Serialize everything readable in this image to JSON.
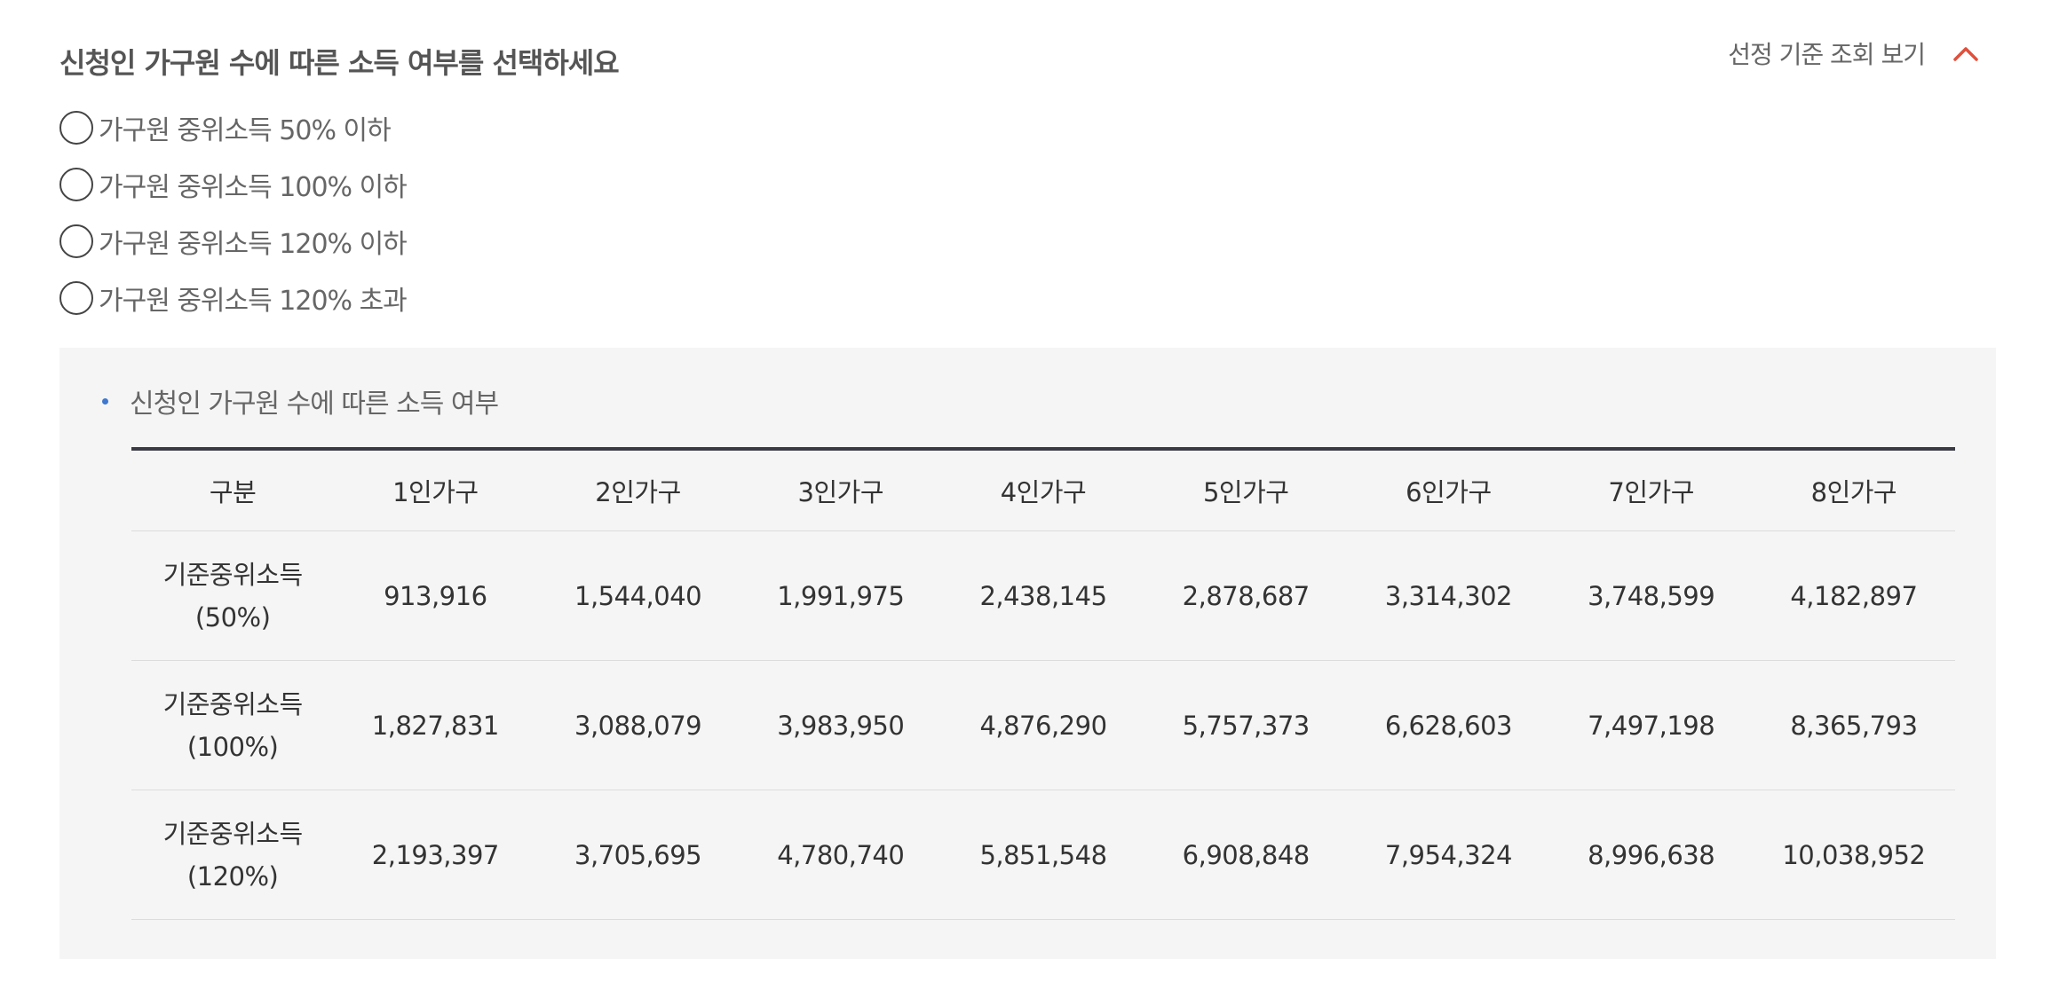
{
  "title": "신청인 가구원 수에 따른 소득 여부를 선택하세요",
  "criteria_toggle": {
    "label": "선정 기준 조회 보기",
    "icon": "chevron-up-icon",
    "icon_color": "#e0503c"
  },
  "options": [
    {
      "label": "가구원 중위소득 50% 이하",
      "selected": false
    },
    {
      "label": "가구원 중위소득 100% 이하",
      "selected": false
    },
    {
      "label": "가구원 중위소득 120% 이하",
      "selected": false
    },
    {
      "label": "가구원 중위소득 120% 초과",
      "selected": false
    }
  ],
  "panel": {
    "heading": "신청인 가구원 수에 따른 소득 여부",
    "bullet_color": "#3e78cf",
    "table": {
      "headers": [
        "구분",
        "1인가구",
        "2인가구",
        "3인가구",
        "4인가구",
        "5인가구",
        "6인가구",
        "7인가구",
        "8인가구"
      ],
      "rows": [
        {
          "label_line1": "기준중위소득",
          "label_line2": "(50%)",
          "values": [
            "913,916",
            "1,544,040",
            "1,991,975",
            "2,438,145",
            "2,878,687",
            "3,314,302",
            "3,748,599",
            "4,182,897"
          ]
        },
        {
          "label_line1": "기준중위소득",
          "label_line2": "(100%)",
          "values": [
            "1,827,831",
            "3,088,079",
            "3,983,950",
            "4,876,290",
            "5,757,373",
            "6,628,603",
            "7,497,198",
            "8,365,793"
          ]
        },
        {
          "label_line1": "기준중위소득",
          "label_line2": "(120%)",
          "values": [
            "2,193,397",
            "3,705,695",
            "4,780,740",
            "5,851,548",
            "6,908,848",
            "7,954,324",
            "8,996,638",
            "10,038,952"
          ]
        }
      ]
    }
  }
}
